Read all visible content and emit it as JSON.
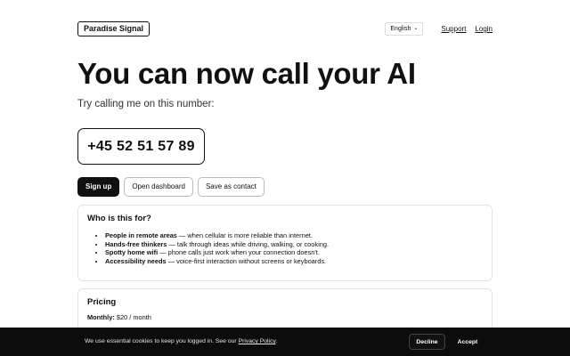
{
  "brand": {
    "name": "Paradise Signal"
  },
  "nav": {
    "language": "English",
    "support": "Support",
    "login": "Login"
  },
  "hero": {
    "title": "You can now call your AI",
    "subtitle": "Try calling me on this number:",
    "phone": "+45 52 51 57 89"
  },
  "actions": {
    "signup": "Sign up",
    "dashboard": "Open dashboard",
    "save_contact": "Save as contact"
  },
  "audience": {
    "title": "Who is this for?",
    "items": [
      {
        "bold": "People in remote areas",
        "text": " — when cellular is more reliable than internet."
      },
      {
        "bold": "Hands-free thinkers",
        "text": " — talk through ideas while driving, walking, or cooking."
      },
      {
        "bold": "Spotty home wifi",
        "text": " — phone calls just work when your connection doesn't."
      },
      {
        "bold": "Accessibility needs",
        "text": " — voice-first interaction without screens or keyboards."
      }
    ]
  },
  "pricing": {
    "title": "Pricing",
    "monthly_label": "Monthly:",
    "monthly_value": " $20 / month"
  },
  "cookie": {
    "text": "We use essential cookies to keep you logged in. See our ",
    "link": "Privacy Policy",
    "end": ".",
    "decline": "Decline",
    "accept": "Accept"
  }
}
